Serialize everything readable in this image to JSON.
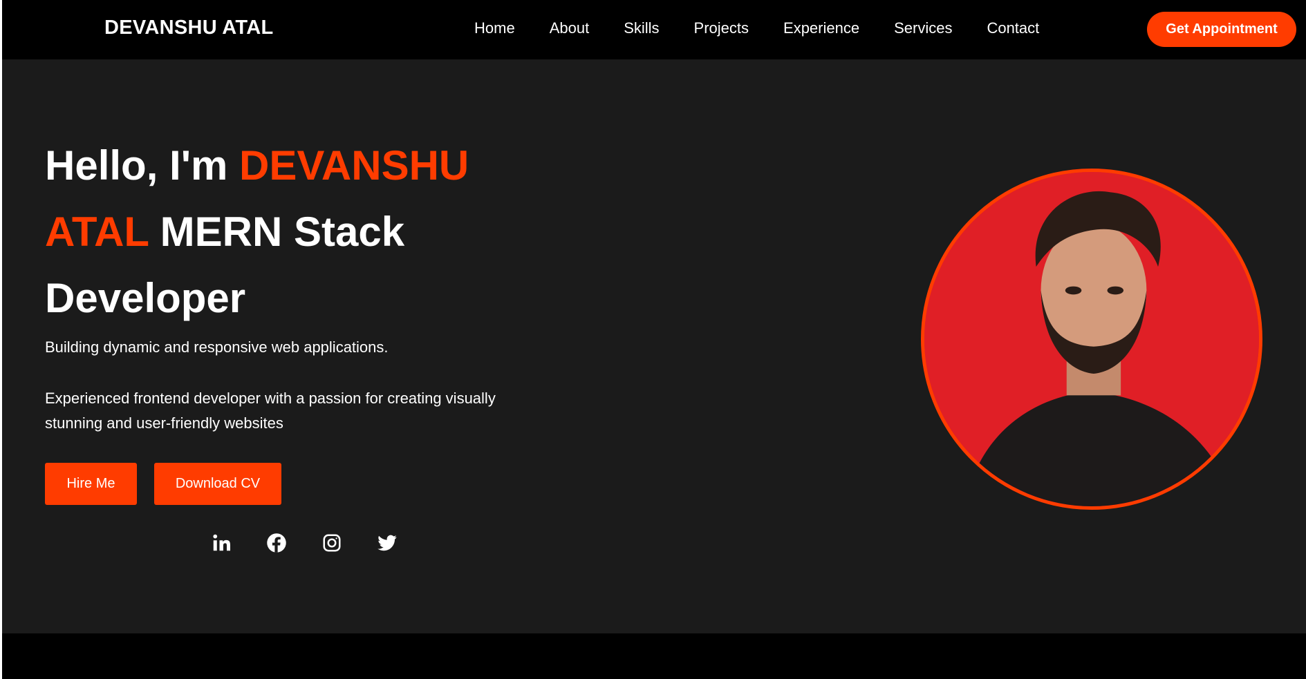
{
  "nav": {
    "brand": "DEVANSHU ATAL",
    "links": [
      "Home",
      "About",
      "Skills",
      "Projects",
      "Experience",
      "Services",
      "Contact"
    ],
    "cta": "Get Appointment"
  },
  "hero": {
    "greeting": "Hello, I'm",
    "name": "DEVANSHU ATAL",
    "role": "MERN Stack Developer",
    "tagline": "Building dynamic and responsive web applications.",
    "description": "Experienced frontend developer with a passion for creating visually stunning and user-friendly websites",
    "buttons": {
      "hire": "Hire Me",
      "cv": "Download CV"
    },
    "socials": [
      "linkedin-icon",
      "facebook-icon",
      "instagram-icon",
      "twitter-icon"
    ]
  },
  "colors": {
    "accent": "#ff3c00",
    "background": "#1b1b1b",
    "navbar": "#000000",
    "portrait_bg": "#e01f26"
  }
}
